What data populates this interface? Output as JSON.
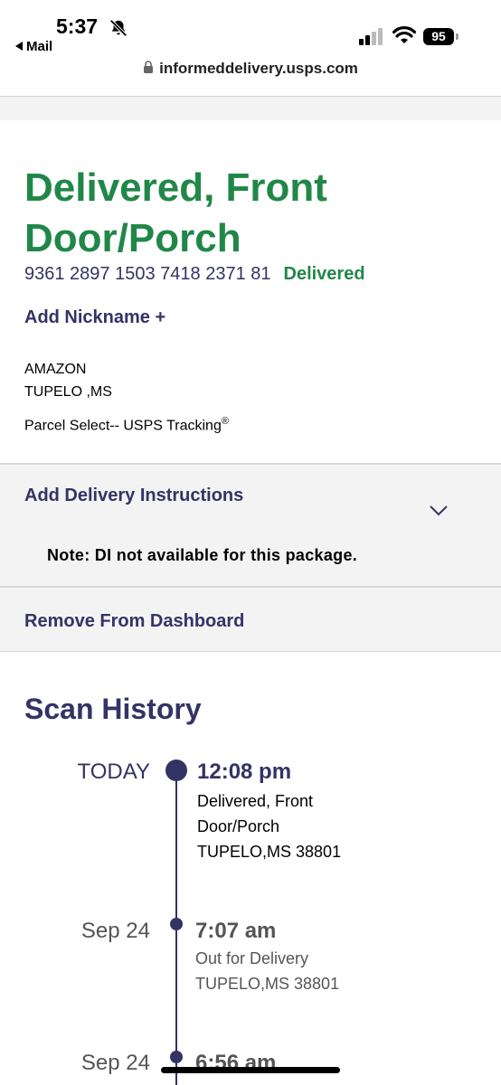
{
  "status_bar": {
    "time": "5:37",
    "back_app": "Mail",
    "battery": "95"
  },
  "browser": {
    "url": "informeddelivery.usps.com"
  },
  "package": {
    "status_title": "Delivered, Front Door/Porch",
    "tracking_number": "9361 2897 1503 7418 2371 81",
    "status_label": "Delivered",
    "add_nickname": "Add Nickname +",
    "sender_name": "AMAZON",
    "sender_location": "TUPELO ,MS",
    "service": "Parcel Select-- USPS Tracking",
    "service_mark": "®"
  },
  "delivery_instructions": {
    "title": "Add Delivery Instructions",
    "note": "Note: DI not available for this package."
  },
  "actions": {
    "remove_from_dashboard": "Remove From Dashboard"
  },
  "scan_history": {
    "title": "Scan History",
    "events": [
      {
        "date": "TODAY",
        "time": "12:08 pm",
        "status_line1": "Delivered, Front",
        "status_line2": "Door/Porch",
        "location": "TUPELO,MS 38801"
      },
      {
        "date": "Sep 24",
        "time": "7:07 am",
        "status": "Out for Delivery",
        "location": "TUPELO,MS 38801"
      },
      {
        "date": "Sep 24",
        "time": "6:56 am"
      }
    ]
  },
  "colors": {
    "delivered_green": "#218748",
    "usps_navy": "#333366",
    "panel_gray": "#f3f3f3"
  }
}
